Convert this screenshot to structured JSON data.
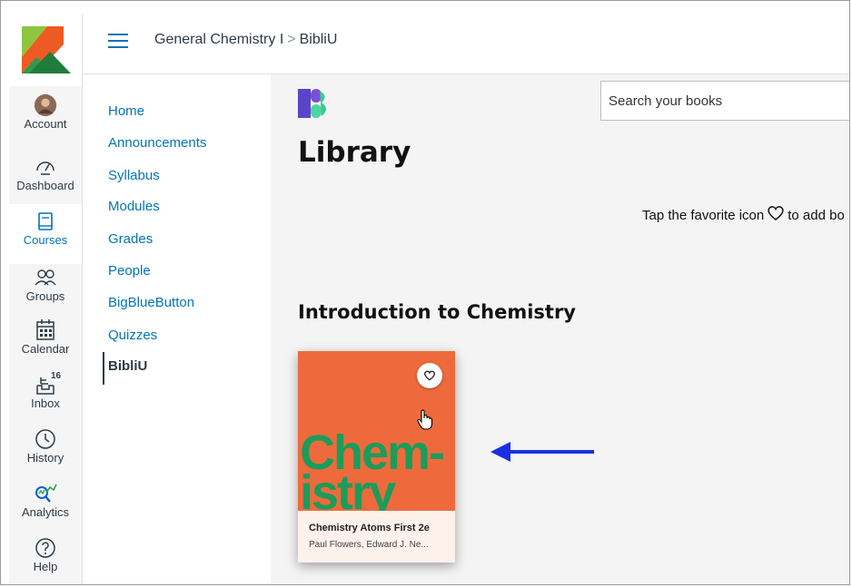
{
  "top_fragment": "y",
  "global_nav": {
    "items": [
      {
        "label": "Account",
        "icon": "avatar"
      },
      {
        "label": "Dashboard",
        "icon": "dashboard-icon"
      },
      {
        "label": "Courses",
        "icon": "courses-icon",
        "active": true
      },
      {
        "label": "Groups",
        "icon": "groups-icon"
      },
      {
        "label": "Calendar",
        "icon": "calendar-icon"
      },
      {
        "label": "Inbox",
        "icon": "inbox-icon",
        "badge": "16"
      },
      {
        "label": "History",
        "icon": "history-icon"
      },
      {
        "label": "Analytics",
        "icon": "analytics-icon"
      },
      {
        "label": "Help",
        "icon": "help-icon"
      }
    ]
  },
  "header": {
    "course": "General Chemistry I",
    "separator": ">",
    "current": "BibliU"
  },
  "course_nav": {
    "items": [
      "Home",
      "Announcements",
      "Syllabus",
      "Modules",
      "Grades",
      "People",
      "BigBlueButton",
      "Quizzes",
      "BibliU"
    ],
    "active": "BibliU"
  },
  "content": {
    "search_placeholder": "Search your books",
    "title": "Library",
    "tap_text_before": "Tap the favorite icon",
    "tap_text_after": "to add bo",
    "section_title": "Introduction to Chemistry",
    "book": {
      "cover_word_1": "Chem-",
      "cover_word_2": "istry",
      "title": "Chemistry Atoms First 2e",
      "authors": "Paul Flowers, Edward J. Ne..."
    }
  },
  "colors": {
    "canvas_blue": "#0374b5",
    "logo_green": "#2e9a4a",
    "logo_orange": "#ee5a24",
    "cover_orange": "#ee6a3c",
    "cover_green": "#1b9c5a",
    "arrow_blue": "#1a2fe0"
  }
}
